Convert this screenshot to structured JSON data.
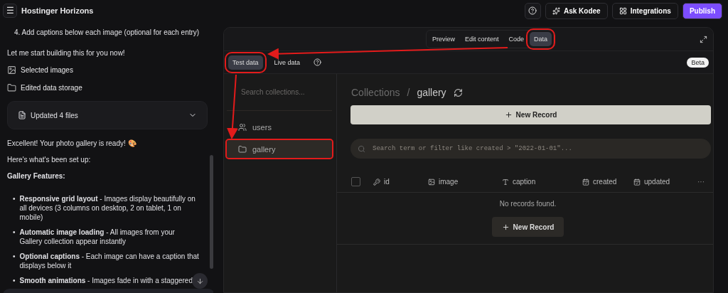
{
  "app_bar": {
    "menu_icon": "☰",
    "title": "Hostinger Horizons",
    "buttons": [
      {
        "kind": "help"
      },
      {
        "kind": "ask",
        "label": "Ask Kodee"
      },
      {
        "kind": "integrations",
        "label": "Integrations"
      },
      {
        "kind": "publish",
        "label": "Publish"
      }
    ]
  },
  "chat": {
    "messages": [
      {
        "kind": "numbered",
        "text": "4. Add captions below each image (optional for each entry)"
      },
      {
        "kind": "paragraph",
        "text": "Let me start building this for you now!"
      },
      {
        "kind": "attachment",
        "text": "Selected images"
      },
      {
        "kind": "attachment",
        "text": "Edited data storage"
      },
      {
        "kind": "files",
        "text": "Updated 4 files",
        "expanded": false
      },
      {
        "kind": "paragraph",
        "text": "Excellent! Your photo gallery is ready! 🎨"
      },
      {
        "kind": "paragraph",
        "text": "Here's what's been set up:"
      },
      {
        "kind": "heading",
        "text": "Gallery Features:"
      },
      {
        "kind": "bullets",
        "items": [
          {
            "marker": "•",
            "text": "**Responsive grid layout** - Images display beautifully on all devices (3 columns on desktop, 2 on tablet, 1 on mobile)"
          },
          {
            "marker": "•",
            "text": "**Automatic image loading** - All images from your Gallery collection appear instantly"
          },
          {
            "marker": "•",
            "text": "**Optional captions** - Each image can have a caption that displays below it"
          },
          {
            "marker": "•",
            "text": "**Smooth animations** - Images fade in with a staggered"
          }
        ]
      }
    ]
  },
  "preview": {
    "view_tabs": [
      {
        "label": "Preview",
        "selected": false,
        "highlighted": false
      },
      {
        "label": "Edit content",
        "selected": false,
        "highlighted": false
      },
      {
        "label": "Code",
        "selected": false,
        "highlighted": false
      },
      {
        "label": "Data",
        "selected": true,
        "highlighted": true
      }
    ],
    "data_tabs": [
      {
        "label": "Test data",
        "selected": true,
        "highlighted": true
      },
      {
        "label": "Live data",
        "selected": false,
        "highlighted": false
      }
    ],
    "badge": "Beta",
    "collections": {
      "placeholder": "Search collections...",
      "items": [
        {
          "label": "users",
          "selected": false,
          "highlighted": false
        },
        {
          "label": "gallery",
          "selected": true,
          "highlighted": true
        }
      ]
    },
    "breadcrumb": [
      "Collections",
      "/",
      "gallery"
    ],
    "new_record_top": "New Record",
    "filter": {
      "placeholder": "Search term or filter like created > \"2022-01-01\"..."
    },
    "table": {
      "select_all": {
        "checked": false
      },
      "columns": [
        {
          "label": "id"
        },
        {
          "label": "image"
        },
        {
          "label": "caption"
        },
        {
          "label": "created"
        },
        {
          "label": "updated"
        }
      ],
      "more": "···",
      "empty": "No records found.",
      "new_record": "New Record"
    }
  }
}
